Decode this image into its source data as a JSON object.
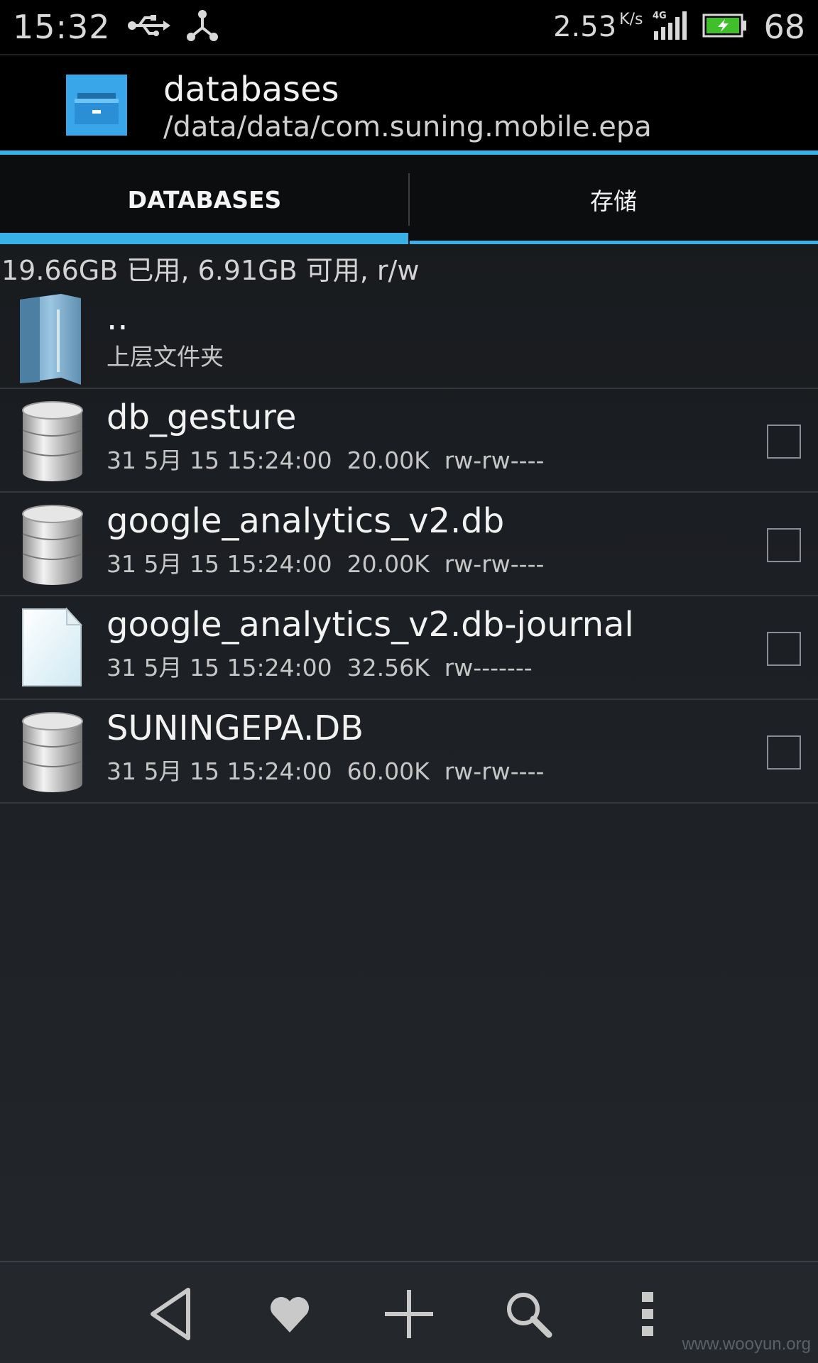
{
  "status_bar": {
    "time": "15:32",
    "speed": "2.53",
    "speed_unit": "K/s",
    "battery_percent": "68",
    "icons": [
      "usb-icon",
      "share-icon",
      "4g-signal-icon",
      "battery-icon"
    ]
  },
  "title_bar": {
    "title": "databases",
    "path": "/data/data/com.suning.mobile.epa",
    "app_icon": "file-manager-icon"
  },
  "tabs": [
    {
      "label": "DATABASES",
      "active": true
    },
    {
      "label": "存储",
      "active": false
    }
  ],
  "storage_info": "19.66GB 已用, 6.91GB 可用, r/w",
  "files": [
    {
      "name": "..",
      "meta": "上层文件夹",
      "icon": "folder-icon",
      "checkbox": false
    },
    {
      "name": "db_gesture",
      "meta": "31 5月 15 15:24:00  20.00K  rw-rw----",
      "icon": "database-icon",
      "checkbox": true
    },
    {
      "name": "google_analytics_v2.db",
      "meta": "31 5月 15 15:24:00  20.00K  rw-rw----",
      "icon": "database-icon",
      "checkbox": true
    },
    {
      "name": "google_analytics_v2.db-journal",
      "meta": "31 5月 15 15:24:00  32.56K  rw-------",
      "icon": "file-icon",
      "checkbox": true
    },
    {
      "name": "SUNINGEPA.DB",
      "meta": "31 5月 15 15:24:00  60.00K  rw-rw----",
      "icon": "database-icon",
      "checkbox": true
    }
  ],
  "bottom_bar": {
    "buttons": [
      "back-icon",
      "favorite-icon",
      "add-icon",
      "search-icon",
      "more-icon"
    ]
  },
  "watermark": "www.wooyun.org",
  "colors": {
    "accent": "#39b1e6",
    "background": "#1f2328",
    "bar": "#000000"
  }
}
